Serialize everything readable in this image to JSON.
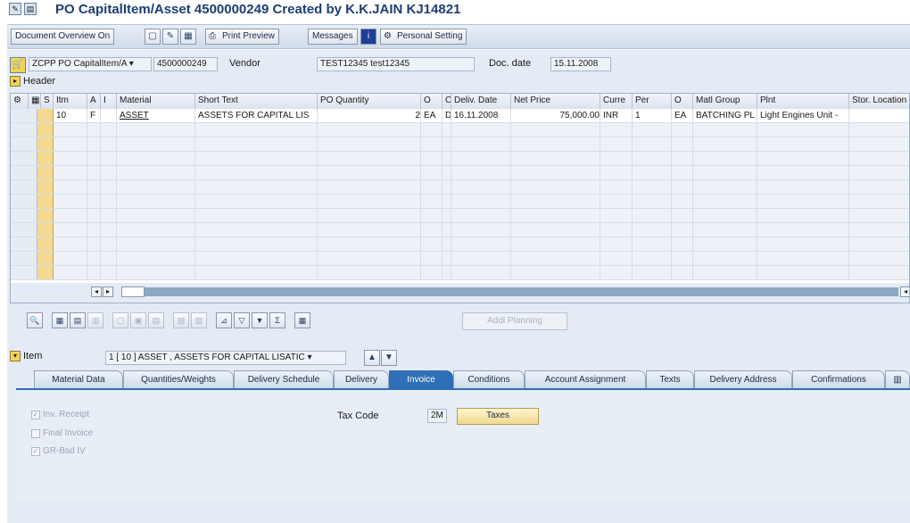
{
  "title": "PO CapitalItem/Asset 4500000249 Created by K.K.JAIN KJ14821",
  "toolbar": {
    "document_overview": "Document Overview On",
    "print_preview": "Print Preview",
    "messages": "Messages",
    "personal_setting": "Personal Setting"
  },
  "doc": {
    "type": "ZCPP PO CapitalItem/A",
    "number": "4500000249",
    "vendor_label": "Vendor",
    "vendor_value": "TEST12345 test12345",
    "date_label": "Doc. date",
    "date_value": "15.11.2008"
  },
  "header_label": "Header",
  "table": {
    "columns": [
      "S",
      "Itm",
      "A",
      "I",
      "Material",
      "Short Text",
      "PO Quantity",
      "O",
      "C",
      "Deliv. Date",
      "Net Price",
      "Curre",
      "Per",
      "O",
      "Matl Group",
      "Plnt",
      "Stor. Location"
    ],
    "rows": [
      [
        "",
        "10",
        "F",
        "",
        "ASSET",
        "ASSETS FOR CAPITAL LIS",
        "2",
        "EA",
        "D",
        "16.11.2008",
        "75,000.00",
        "INR",
        "1",
        "EA",
        "BATCHING PL",
        "Light Engines Unit -",
        ""
      ]
    ]
  },
  "addl_planning": "Addl Planning",
  "item": {
    "label": "Item",
    "selected": "1 [ 10 ] ASSET , ASSETS FOR CAPITAL LISATIC"
  },
  "tabs": [
    "Material Data",
    "Quantities/Weights",
    "Delivery Schedule",
    "Delivery",
    "Invoice",
    "Conditions",
    "Account Assignment",
    "Texts",
    "Delivery Address",
    "Confirmations"
  ],
  "invoice": {
    "inv_receipt": "Inv. Receipt",
    "final_invoice": "Final Invoice",
    "gr_bsd_iv": "GR-Bsd IV",
    "tax_code_label": "Tax Code",
    "tax_code_value": "2M",
    "taxes_button": "Taxes"
  },
  "colors": {
    "title": "#1d3f73",
    "active_tab": "#2e6fb8",
    "selection": "#f5d990"
  }
}
